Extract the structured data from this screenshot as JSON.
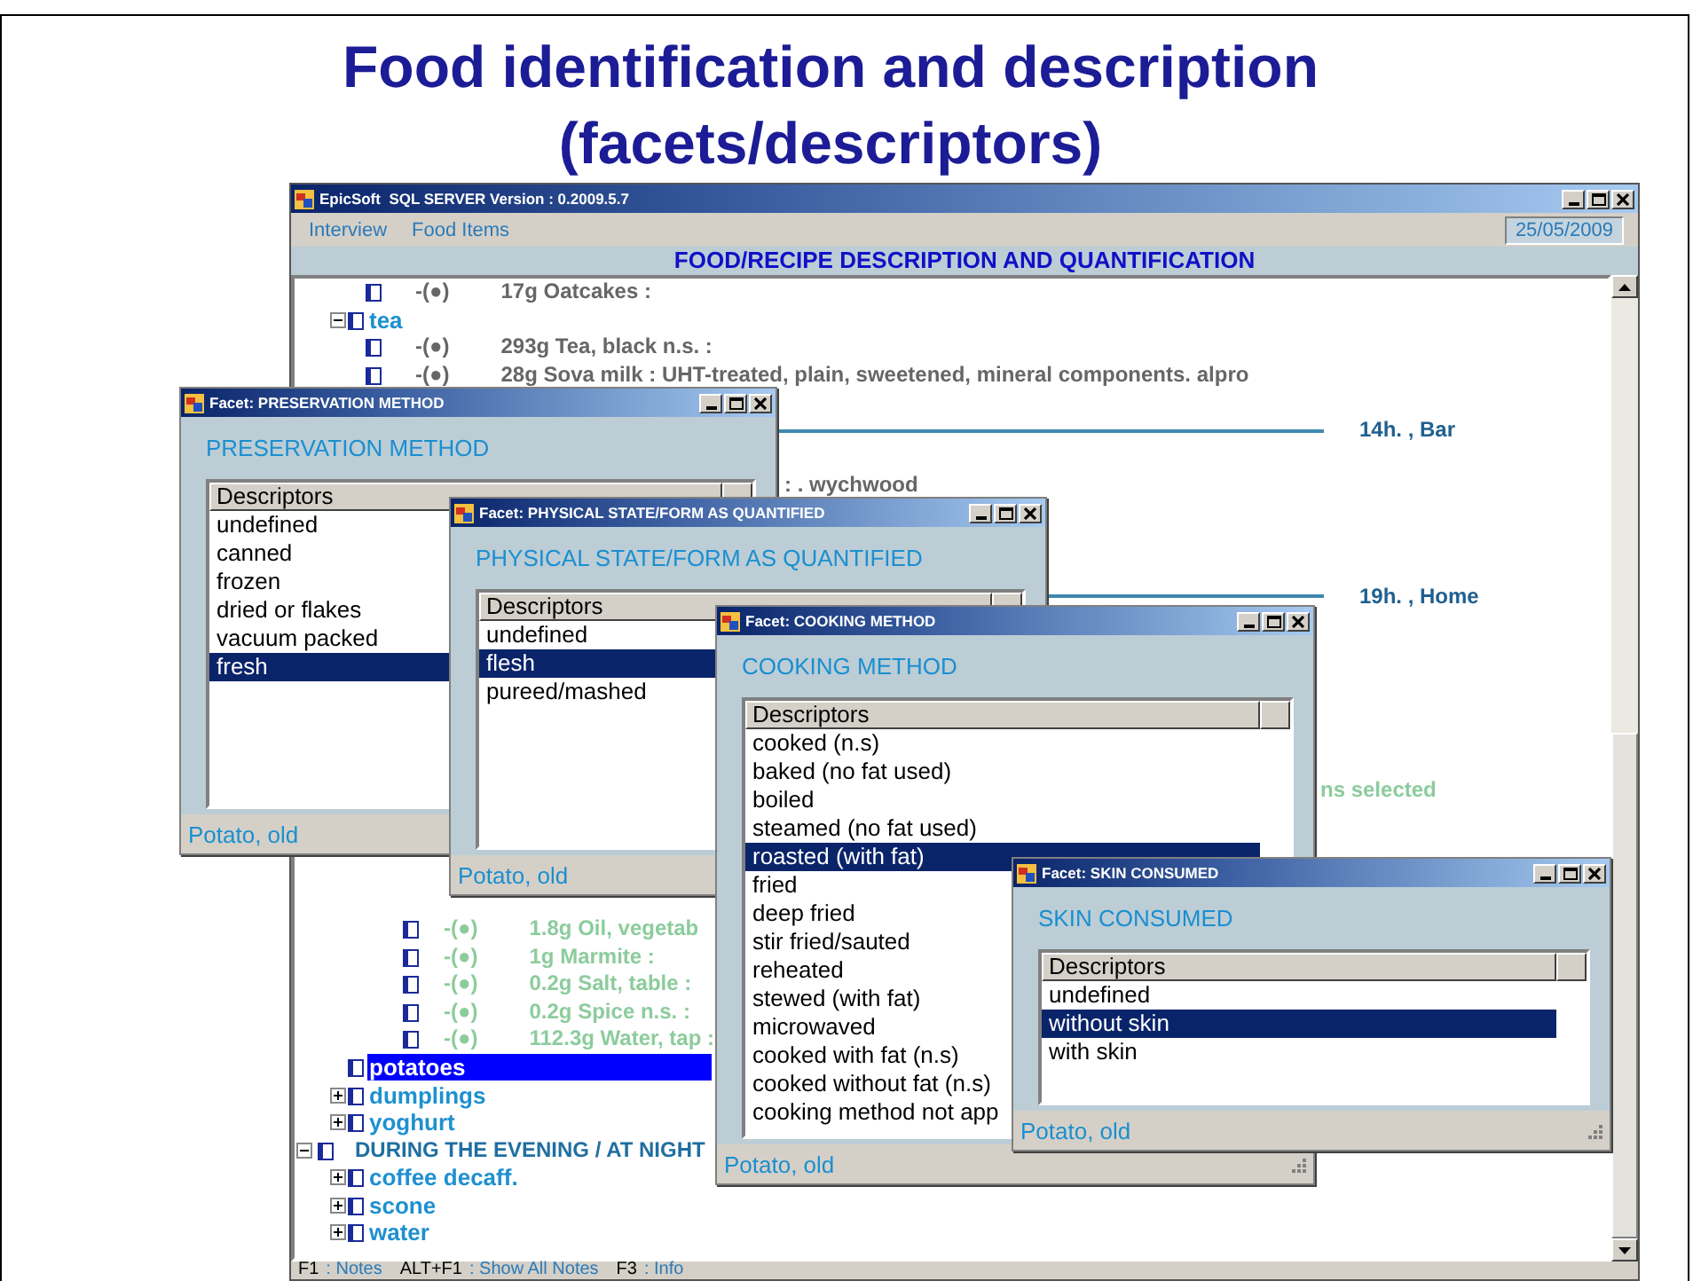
{
  "slide": {
    "title_lines": [
      "Food identification and description",
      "(facets/descriptors)"
    ]
  },
  "main_window": {
    "title": "EpicSoft  SQL SERVER Version : 0.2009.5.7",
    "menu": [
      "Interview",
      "Food Items"
    ],
    "date": "25/05/2009",
    "header": "FOOD/RECIPE DESCRIPTION AND QUANTIFICATION",
    "tree": [
      {
        "kind": "leaf",
        "marker": "-(●)",
        "text": "17g Oatcakes :",
        "color": "#666666"
      },
      {
        "kind": "group",
        "label": "tea",
        "expanded": true,
        "selected": false,
        "children": [
          {
            "kind": "leaf",
            "marker": "-(●)",
            "text": "293g Tea, black n.s. :",
            "color": "#666666"
          },
          {
            "kind": "leaf",
            "marker": "-(●)",
            "text": "28g Sova milk : UHT-treated, plain, sweetened, mineral components. alpro",
            "color": "#666666"
          }
        ]
      },
      {
        "kind": "timeline",
        "text": "14h. , Bar"
      },
      {
        "kind": "fragment",
        "text": ": . wychwood",
        "color": "#666666"
      },
      {
        "kind": "timeline",
        "text": "19h. , Home"
      },
      {
        "kind": "summary",
        "text": "ns selected",
        "color": "#8ccc9c"
      },
      {
        "kind": "ingredient",
        "marker": "-(●)",
        "text": "1.8g Oil, vegetab",
        "color": "#8ccc9c"
      },
      {
        "kind": "ingredient",
        "marker": "-(●)",
        "text": "1g Marmite :",
        "color": "#8ccc9c"
      },
      {
        "kind": "ingredient",
        "marker": "-(●)",
        "text": "0.2g Salt, table :",
        "color": "#8ccc9c"
      },
      {
        "kind": "ingredient",
        "marker": "-(●)",
        "text": "0.2g Spice n.s. :",
        "color": "#8ccc9c"
      },
      {
        "kind": "ingredient",
        "marker": "-(●)",
        "text": "112.3g Water, tap :",
        "color": "#8ccc9c"
      },
      {
        "kind": "group",
        "label": "potatoes",
        "selected": true
      },
      {
        "kind": "group",
        "label": "dumplings",
        "expanded": false,
        "selected": false
      },
      {
        "kind": "group",
        "label": "yoghurt",
        "expanded": false,
        "selected": false
      },
      {
        "kind": "section",
        "label": "DURING THE EVENING / AT NIGHT",
        "expanded": true,
        "children": [
          {
            "kind": "group",
            "label": "coffee decaff.",
            "expanded": false,
            "selected": false
          },
          {
            "kind": "group",
            "label": "scone",
            "expanded": false,
            "selected": false
          },
          {
            "kind": "group",
            "label": "water",
            "expanded": false,
            "selected": false
          }
        ]
      }
    ],
    "status_bar": [
      {
        "key": "F1",
        "action": ": Notes"
      },
      {
        "key": "ALT+F1",
        "action": ": Show All Notes"
      },
      {
        "key": "F3",
        "action": ": Info"
      }
    ]
  },
  "dialogs": [
    {
      "title": "Facet: PRESERVATION METHOD",
      "heading": "PRESERVATION METHOD",
      "column": "Descriptors",
      "footer": "Potato, old",
      "items": [
        {
          "label": "undefined",
          "selected": false
        },
        {
          "label": "canned",
          "selected": false
        },
        {
          "label": "frozen",
          "selected": false
        },
        {
          "label": "dried or flakes",
          "selected": false
        },
        {
          "label": "vacuum packed",
          "selected": false
        },
        {
          "label": "fresh",
          "selected": true
        }
      ]
    },
    {
      "title": "Facet: PHYSICAL STATE/FORM AS QUANTIFIED",
      "heading": "PHYSICAL STATE/FORM AS QUANTIFIED",
      "column": "Descriptors",
      "footer": "Potato, old",
      "items": [
        {
          "label": "undefined",
          "selected": false
        },
        {
          "label": "flesh",
          "selected": true
        },
        {
          "label": "pureed/mashed",
          "selected": false
        }
      ]
    },
    {
      "title": "Facet: COOKING METHOD",
      "heading": "COOKING METHOD",
      "column": "Descriptors",
      "footer": "Potato, old",
      "items": [
        {
          "label": "cooked (n.s)",
          "selected": false
        },
        {
          "label": "baked (no fat used)",
          "selected": false
        },
        {
          "label": "boiled",
          "selected": false
        },
        {
          "label": "steamed (no fat used)",
          "selected": false
        },
        {
          "label": "roasted (with fat)",
          "selected": true
        },
        {
          "label": "fried",
          "selected": false
        },
        {
          "label": "deep fried",
          "selected": false
        },
        {
          "label": "stir fried/sauted",
          "selected": false
        },
        {
          "label": "reheated",
          "selected": false
        },
        {
          "label": "stewed (with fat)",
          "selected": false
        },
        {
          "label": "microwaved",
          "selected": false
        },
        {
          "label": "cooked with fat (n.s)",
          "selected": false
        },
        {
          "label": "cooked without fat (n.s)",
          "selected": false
        },
        {
          "label": "cooking method not app",
          "selected": false
        }
      ]
    },
    {
      "title": "Facet: SKIN CONSUMED",
      "heading": "SKIN CONSUMED",
      "column": "Descriptors",
      "footer": "Potato, old",
      "items": [
        {
          "label": "undefined",
          "selected": false
        },
        {
          "label": "without skin",
          "selected": true
        },
        {
          "label": "with skin",
          "selected": false
        }
      ]
    }
  ]
}
